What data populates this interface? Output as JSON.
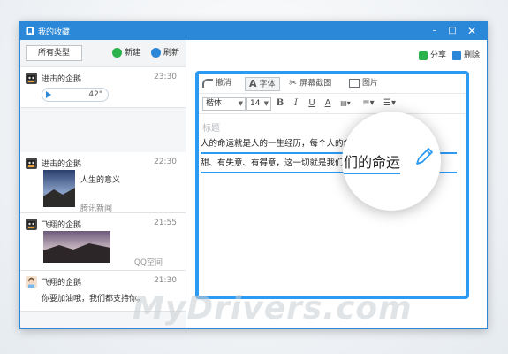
{
  "window": {
    "title": "我的收藏",
    "controls": {
      "minimize": "–",
      "maximize": "□",
      "close": "✕"
    }
  },
  "sidebar": {
    "filter_label": "所有类型",
    "new_label": "新建",
    "refresh_label": "刷新",
    "items": [
      {
        "type": "voice",
        "name": "进击的企鹅",
        "time": "23:30",
        "duration": "42\""
      },
      {
        "type": "link",
        "name": "进击的企鹅",
        "time": "22:30",
        "title": "人生的意义",
        "source": "腾讯新闻"
      },
      {
        "type": "image",
        "name": "飞翔的企鹅",
        "time": "21:55",
        "source": "QQ空间"
      },
      {
        "type": "text",
        "name": "飞翔的企鹅",
        "time": "21:30",
        "message": "你要加油哦，我们都支持你。"
      }
    ]
  },
  "main": {
    "share_label": "分享",
    "delete_label": "删除",
    "toolbar": {
      "undo": "撤消",
      "font": "字体",
      "screenshot": "屏幕截图",
      "image": "图片"
    },
    "format": {
      "font_family": "楷体",
      "font_size": "14",
      "bold": "B",
      "italic": "I",
      "underline": "U",
      "color": "A"
    },
    "title_placeholder": "标题",
    "body_lines": [
      "人的命运就是人的一生经历，每个人的命运都不同，有苦、有",
      "甜、有失意、有得意，这一切就是我们的命运"
    ]
  },
  "magnifier": {
    "text": "们的命运",
    "icon": "pencil-icon"
  },
  "watermark": "MyDrivers.com",
  "colors": {
    "accent": "#2b88d8",
    "highlight": "#2b9af3",
    "green": "#2cb24a"
  }
}
